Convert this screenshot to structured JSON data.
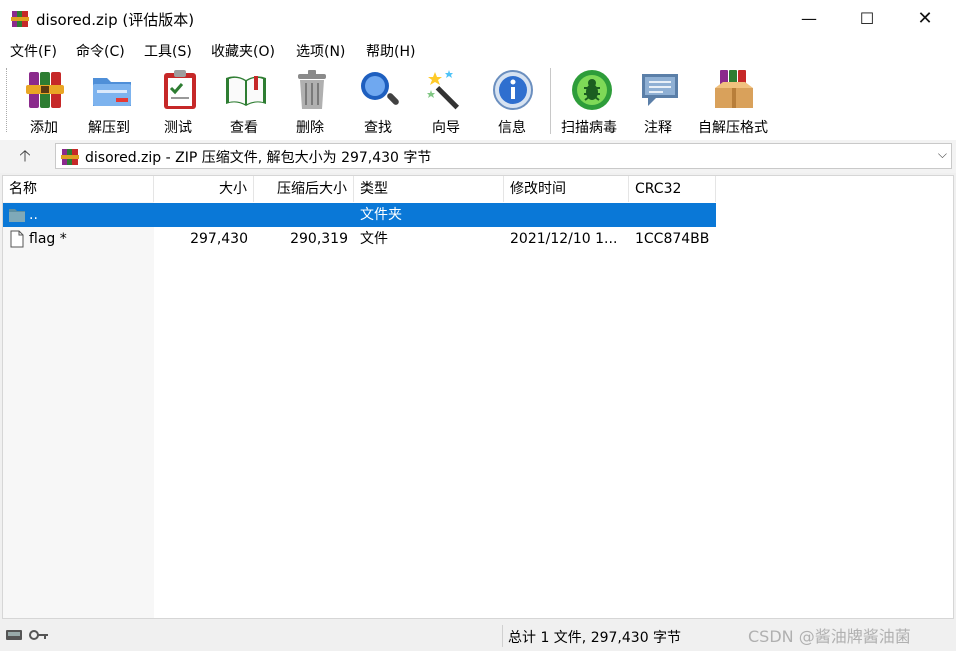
{
  "window": {
    "title": "disored.zip (评估版本)",
    "minimize_glyph": "—",
    "maximize_glyph": "☐",
    "close_glyph": "✕"
  },
  "menu": [
    {
      "label": "文件(F)"
    },
    {
      "label": "命令(C)"
    },
    {
      "label": "工具(S)"
    },
    {
      "label": "收藏夹(O)"
    },
    {
      "label": "选项(N)"
    },
    {
      "label": "帮助(H)"
    }
  ],
  "toolbar": [
    {
      "label": "添加",
      "icon": "winrar-books-icon"
    },
    {
      "label": "解压到",
      "icon": "folder-extract-icon"
    },
    {
      "label": "测试",
      "icon": "clipboard-check-icon"
    },
    {
      "label": "查看",
      "icon": "open-book-icon"
    },
    {
      "label": "删除",
      "icon": "trash-can-icon"
    },
    {
      "label": "查找",
      "icon": "magnifier-icon"
    },
    {
      "label": "向导",
      "icon": "magic-wand-icon"
    },
    {
      "label": "信息",
      "icon": "info-icon"
    },
    {
      "label": "扫描病毒",
      "icon": "virus-scan-icon"
    },
    {
      "label": "注释",
      "icon": "speech-bubble-icon"
    },
    {
      "label": "自解压格式",
      "icon": "sfx-box-icon"
    }
  ],
  "address": {
    "up_glyph": "🡡",
    "path": "disored.zip - ZIP 压缩文件, 解包大小为 297,430 字节",
    "dropdown_glyph": "⌵"
  },
  "columns": [
    "名称",
    "大小",
    "压缩后大小",
    "类型",
    "修改时间",
    "CRC32"
  ],
  "rows": [
    {
      "name": "..",
      "size": "",
      "packed": "",
      "type": "文件夹",
      "modified": "",
      "crc": "",
      "selected": true,
      "icon": "folder-icon"
    },
    {
      "name": "flag *",
      "size": "297,430",
      "packed": "290,319",
      "type": "文件",
      "modified": "2021/12/10 1...",
      "crc": "1CC874BB",
      "selected": false,
      "icon": "file-icon"
    }
  ],
  "status": {
    "summary": "总计 1 文件, 297,430 字节",
    "watermark": "CSDN @酱油牌酱油菌"
  },
  "colors": {
    "selection": "#0a78d7",
    "window_bg": "#f0f0f0"
  }
}
